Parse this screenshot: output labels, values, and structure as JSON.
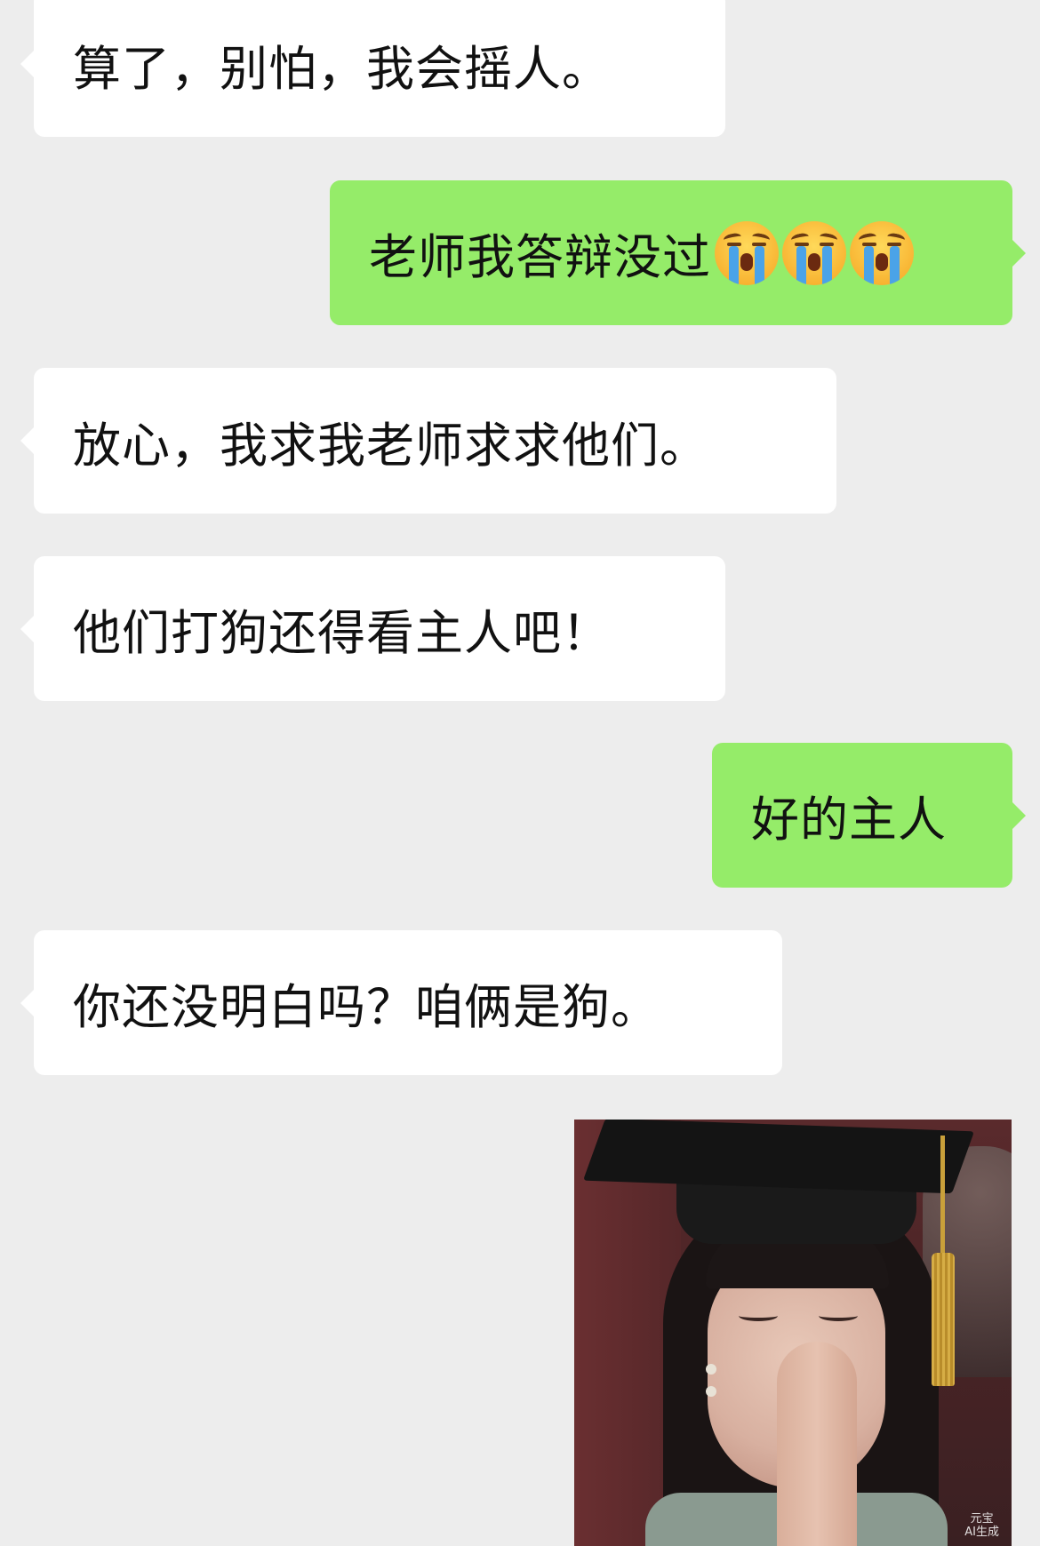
{
  "messages": [
    {
      "side": "in",
      "text": "算了，别怕，我会摇人。"
    },
    {
      "side": "out",
      "text": "老师我答辩没过",
      "emojis": [
        "crying-face",
        "crying-face",
        "crying-face"
      ]
    },
    {
      "side": "in",
      "text": "放心，我求我老师求求他们。"
    },
    {
      "side": "in",
      "text": "他们打狗还得看主人吧！"
    },
    {
      "side": "out",
      "text": "好的主人"
    },
    {
      "side": "in",
      "text": "你还没明白吗？咱俩是狗。"
    },
    {
      "side": "in",
      "type": "image",
      "watermark": [
        "元宝",
        "AI生成"
      ]
    }
  ],
  "colors": {
    "background": "#ededed",
    "incoming_bubble": "#ffffff",
    "outgoing_bubble": "#95ec69",
    "text": "#111111"
  }
}
